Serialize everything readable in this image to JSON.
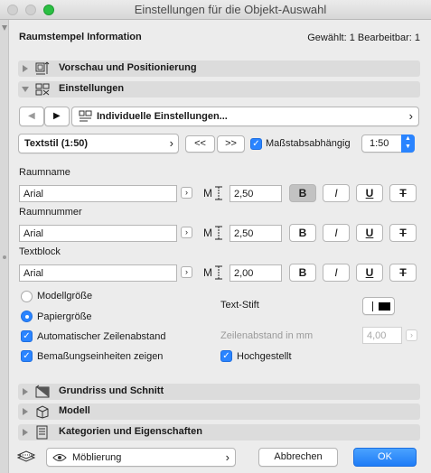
{
  "window": {
    "title": "Einstellungen für die Objekt-Auswahl"
  },
  "header": {
    "title": "Raumstempel Information",
    "count": "Gewählt: 1 Bearbeitbar: 1"
  },
  "sections": {
    "preview": "Vorschau und Positionierung",
    "settings": "Einstellungen",
    "floorplan": "Grundriss und Schnitt",
    "model": "Modell",
    "categories": "Kategorien und Eigenschaften"
  },
  "nav": {
    "prev": "◀",
    "next": "▶",
    "dropdown": "Individuelle Einstellungen...",
    "dropdown_arrow": "›"
  },
  "textstyle": {
    "select": "Textstil (1:50)",
    "select_arrow": "›",
    "prev": "<<",
    "next": ">>",
    "scale_label": "Maßstabsabhängig",
    "scale_value": "1:50"
  },
  "rows": [
    {
      "label": "Raumname",
      "font": "Arial",
      "size": "2,50",
      "bold_active": true
    },
    {
      "label": "Raumnummer",
      "font": "Arial",
      "size": "2,50",
      "bold_active": false
    },
    {
      "label": "Textblock",
      "font": "Arial",
      "size": "2,00",
      "bold_active": false
    }
  ],
  "format_buttons": {
    "bold": "B",
    "italic": "I",
    "underline": "U",
    "strike": "T"
  },
  "options": {
    "model_size": "Modellgröße",
    "paper_size": "Papiergröße",
    "auto_line_spacing": "Automatischer Zeilenabstand",
    "show_units": "Bemaßungseinheiten zeigen",
    "text_pen": "Text-Stift",
    "line_spacing": "Zeilenabstand in mm",
    "line_spacing_value": "4,00",
    "superscript": "Hochgestellt"
  },
  "footer": {
    "layer": "Möblierung",
    "cancel": "Abbrechen",
    "ok": "OK"
  },
  "colors": {
    "accent": "#2a84ff",
    "traffic_green": "#2bbf43"
  }
}
